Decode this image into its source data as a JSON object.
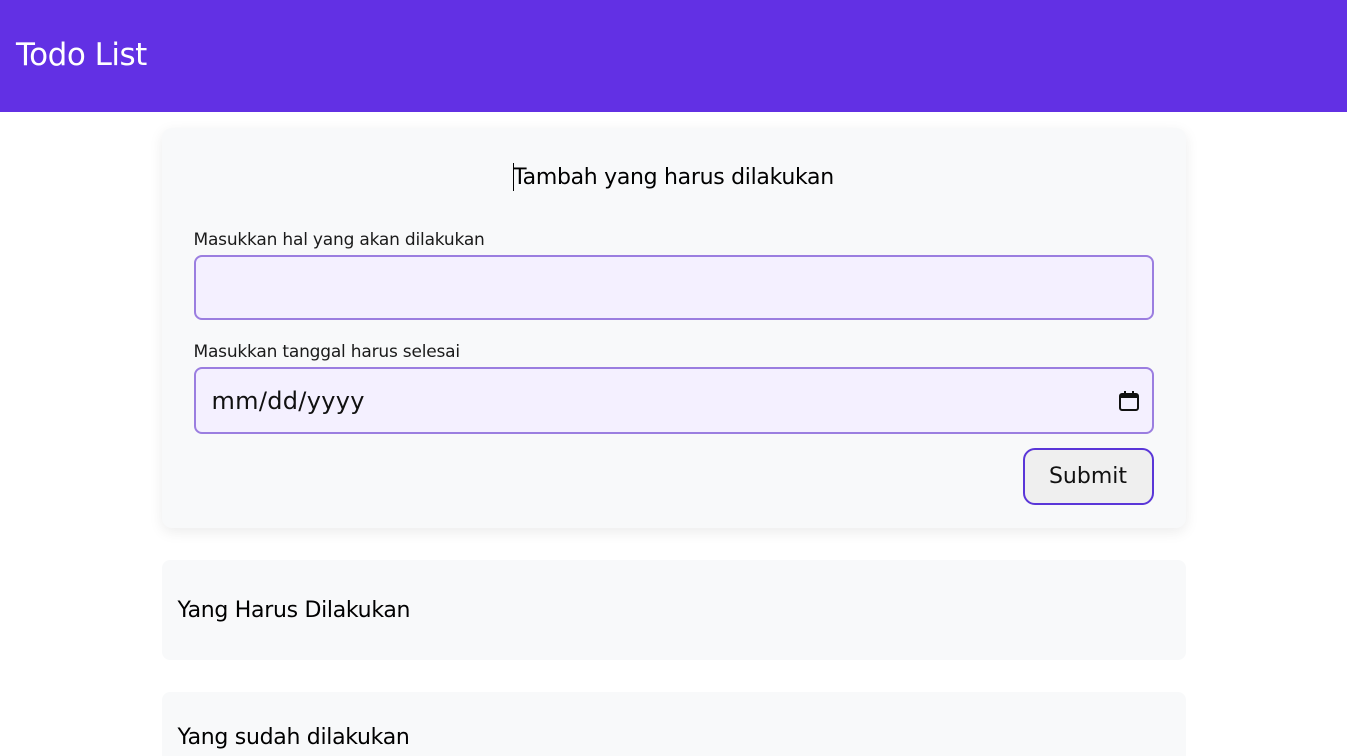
{
  "header": {
    "title": "Todo List"
  },
  "form": {
    "title": "Tambah yang harus dilakukan",
    "task_label": "Masukkan hal yang akan dilakukan",
    "task_value": "",
    "date_label": "Masukkan tanggal harus selesai",
    "date_placeholder": "mm/dd/yyyy",
    "submit_label": "Submit"
  },
  "sections": {
    "todo_title": "Yang Harus Dilakukan",
    "done_title": "Yang sudah dilakukan"
  },
  "colors": {
    "header_bg": "#6230e4",
    "input_bg": "#f4f0ff",
    "input_border": "#9b7ee0",
    "button_border": "#5a36d8"
  },
  "icons": {
    "date_picker": "calendar-icon"
  }
}
